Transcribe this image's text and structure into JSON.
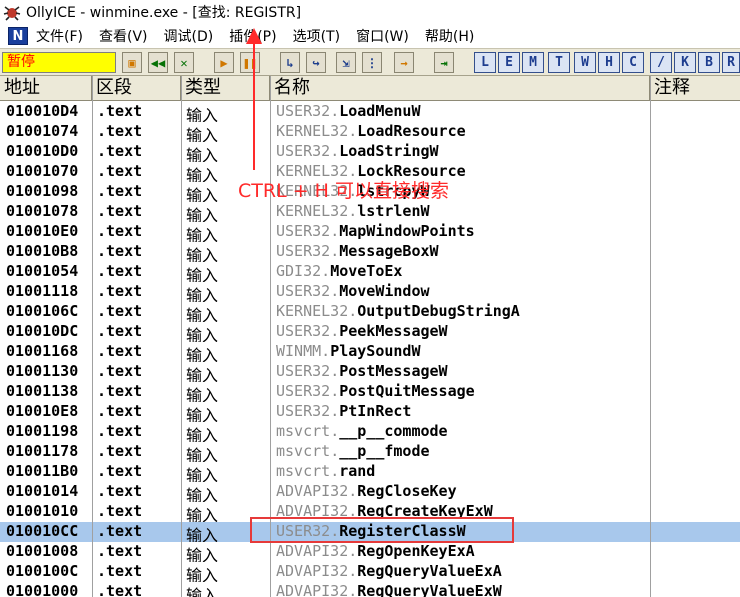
{
  "window": {
    "title": "OllyICE - winmine.exe - [查找: REGISTR]",
    "icon": "ollydbg-bug-icon"
  },
  "menu": {
    "logo": "N",
    "items": [
      "文件(F)",
      "查看(V)",
      "调试(D)",
      "插件(P)",
      "选项(T)",
      "窗口(W)",
      "帮助(H)"
    ]
  },
  "toolbar": {
    "status": "暂停",
    "buttons": [
      "open-icon",
      "rewind-icon",
      "close-icon",
      "run-icon",
      "pause-icon",
      "step-into-icon",
      "step-over-icon",
      "trace-into-icon",
      "trace-over-icon",
      "execute-till-return-icon",
      "goto-icon"
    ],
    "letters": [
      "L",
      "E",
      "M",
      "T",
      "W",
      "H",
      "C",
      "/",
      "K",
      "B",
      "R"
    ]
  },
  "table": {
    "headers": [
      "地址",
      "区段",
      "类型",
      "名称",
      "注释"
    ],
    "rows": [
      {
        "addr": "010010D4",
        "section": ".text",
        "type": "输入",
        "module": "USER32",
        "func": "LoadMenuW"
      },
      {
        "addr": "01001074",
        "section": ".text",
        "type": "输入",
        "module": "KERNEL32",
        "func": "LoadResource"
      },
      {
        "addr": "010010D0",
        "section": ".text",
        "type": "输入",
        "module": "USER32",
        "func": "LoadStringW"
      },
      {
        "addr": "01001070",
        "section": ".text",
        "type": "输入",
        "module": "KERNEL32",
        "func": "LockResource"
      },
      {
        "addr": "01001098",
        "section": ".text",
        "type": "输入",
        "module": "KERNEL32",
        "func": "lstrcpyW"
      },
      {
        "addr": "01001078",
        "section": ".text",
        "type": "输入",
        "module": "KERNEL32",
        "func": "lstrlenW"
      },
      {
        "addr": "010010E0",
        "section": ".text",
        "type": "输入",
        "module": "USER32",
        "func": "MapWindowPoints"
      },
      {
        "addr": "010010B8",
        "section": ".text",
        "type": "输入",
        "module": "USER32",
        "func": "MessageBoxW"
      },
      {
        "addr": "01001054",
        "section": ".text",
        "type": "输入",
        "module": "GDI32",
        "func": "MoveToEx"
      },
      {
        "addr": "01001118",
        "section": ".text",
        "type": "输入",
        "module": "USER32",
        "func": "MoveWindow"
      },
      {
        "addr": "0100106C",
        "section": ".text",
        "type": "输入",
        "module": "KERNEL32",
        "func": "OutputDebugStringA"
      },
      {
        "addr": "010010DC",
        "section": ".text",
        "type": "输入",
        "module": "USER32",
        "func": "PeekMessageW"
      },
      {
        "addr": "01001168",
        "section": ".text",
        "type": "输入",
        "module": "WINMM",
        "func": "PlaySoundW"
      },
      {
        "addr": "01001130",
        "section": ".text",
        "type": "输入",
        "module": "USER32",
        "func": "PostMessageW"
      },
      {
        "addr": "01001138",
        "section": ".text",
        "type": "输入",
        "module": "USER32",
        "func": "PostQuitMessage"
      },
      {
        "addr": "010010E8",
        "section": ".text",
        "type": "输入",
        "module": "USER32",
        "func": "PtInRect"
      },
      {
        "addr": "01001198",
        "section": ".text",
        "type": "输入",
        "module": "msvcrt",
        "func": "__p__commode"
      },
      {
        "addr": "01001178",
        "section": ".text",
        "type": "输入",
        "module": "msvcrt",
        "func": "__p__fmode"
      },
      {
        "addr": "010011B0",
        "section": ".text",
        "type": "输入",
        "module": "msvcrt",
        "func": "rand"
      },
      {
        "addr": "01001014",
        "section": ".text",
        "type": "输入",
        "module": "ADVAPI32",
        "func": "RegCloseKey"
      },
      {
        "addr": "01001010",
        "section": ".text",
        "type": "输入",
        "module": "ADVAPI32",
        "func": "RegCreateKeyExW"
      },
      {
        "addr": "010010CC",
        "section": ".text",
        "type": "输入",
        "module": "USER32",
        "func": "RegisterClassW",
        "selected": true
      },
      {
        "addr": "01001008",
        "section": ".text",
        "type": "输入",
        "module": "ADVAPI32",
        "func": "RegOpenKeyExA"
      },
      {
        "addr": "0100100C",
        "section": ".text",
        "type": "输入",
        "module": "ADVAPI32",
        "func": "RegQueryValueExA"
      },
      {
        "addr": "01001000",
        "section": ".text",
        "type": "输入",
        "module": "ADVAPI32",
        "func": "RegQueryValueExW"
      }
    ]
  },
  "annotation": {
    "text": "CTRL + H 可以直接搜索",
    "color": "#ff2a2a"
  }
}
